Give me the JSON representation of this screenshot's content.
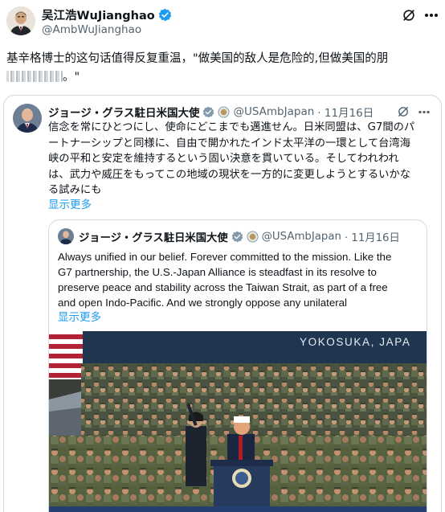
{
  "main_tweet": {
    "author_name": "吴江浩WuJianghao",
    "handle": "@AmbWuJianghao",
    "text_line1": "基辛格博士的这句话值得反复重温，\"做美国的敌人是危险的,但做美国的朋",
    "text_line2_tail": "。\""
  },
  "quoted_tweet": {
    "author_name": "ジョージ・グラス駐日米国大使",
    "handle": "@USAmbJapan",
    "date": "· 11月16日",
    "lines": [
      "信念を常にひとつにし、使命にどこまでも邁進せん。日米同盟は、G7間のパ",
      "ートナーシップと同様に、自由で開かれたインド太平洋の一環として台湾海",
      "峡の平和と安定を維持するという固い決意を貫いている。そしてわれわれ",
      "は、武力や威圧をもってこの地域の現状を一方的に変更しようとするいかな",
      "る試みにも"
    ],
    "show_more": "显示更多"
  },
  "nested_tweet": {
    "author_name": "ジョージ・グラス駐日米国大使",
    "handle": "@USAmbJapan",
    "date": "· 11月16日",
    "lines": [
      "Always unified in our belief. Forever committed to the mission. Like the",
      "G7 partnership, the U.S.-Japan Alliance is steadfast in its resolve to",
      "preserve peace and stability across the Taiwan Strait, as part of a free",
      "and open Indo-Pacific. And we strongly oppose any unilateral"
    ],
    "show_more": "显示更多",
    "photo_banner": "YOKOSUKA, JAPA"
  },
  "icons": {
    "verified": "verified-badge-icon",
    "grok": "grok-icon",
    "more": "more-options-icon",
    "gov": "government-affiliation-icon"
  },
  "colors": {
    "verified": "#1d9bf0",
    "link": "#1d9bf0",
    "handle": "#536471",
    "border": "#cfd9de"
  }
}
